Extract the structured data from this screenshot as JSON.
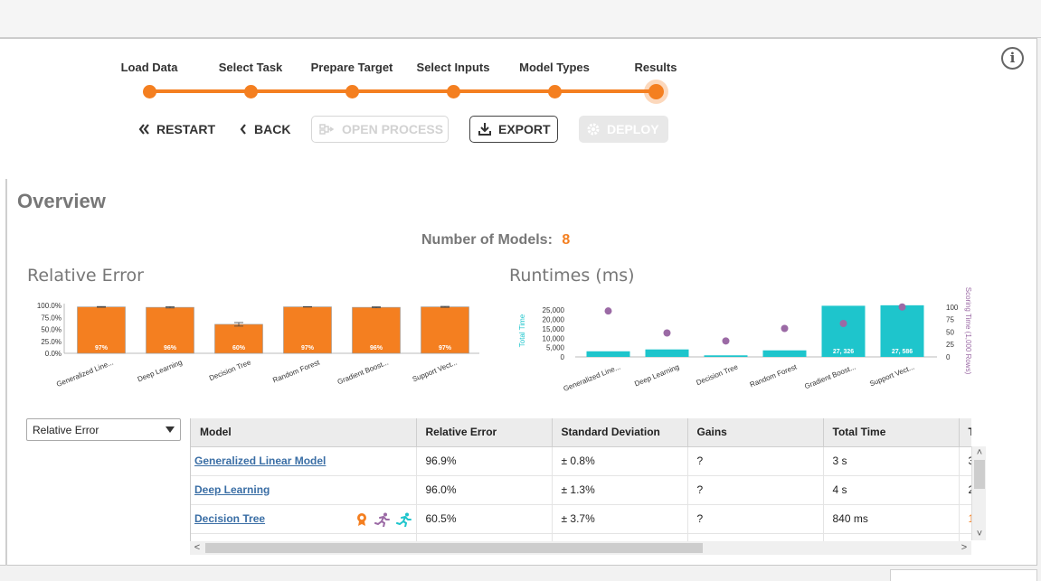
{
  "wizard": {
    "steps": [
      "Load Data",
      "Select Task",
      "Prepare Target",
      "Select Inputs",
      "Model Types",
      "Results"
    ],
    "active_step": "Results"
  },
  "toolbar": {
    "restart_label": "RESTART",
    "back_label": "BACK",
    "open_process_label": "OPEN PROCESS",
    "export_label": "EXPORT",
    "deploy_label": "DEPLOY"
  },
  "overview": {
    "title": "Overview",
    "models_label": "Number of Models:",
    "models_count": "8"
  },
  "colors": {
    "accent": "#f47f20",
    "runtime_bar": "#1ec5cc",
    "scoring_dot": "#9b6aa5",
    "link": "#3a6ea5"
  },
  "chart_data": [
    {
      "type": "bar",
      "title": "Relative Error",
      "categories": [
        "Generalized Line...",
        "Deep Learning",
        "Decision Tree",
        "Random Forest",
        "Gradient Boost...",
        "Support Vect..."
      ],
      "values": [
        96.9,
        96.0,
        60.5,
        97,
        96,
        97
      ],
      "data_labels": [
        "97%",
        "96%",
        "60%",
        "97%",
        "96%",
        "97%"
      ],
      "error": [
        0.8,
        1.3,
        3.7,
        0.5,
        1.0,
        1.0
      ],
      "ylim": [
        0,
        100
      ],
      "yticks": [
        "0.0%",
        "25.0%",
        "50.0%",
        "75.0%",
        "100.0%"
      ],
      "grid": false
    },
    {
      "type": "bar",
      "title": "Runtimes (ms)",
      "categories": [
        "Generalized Line...",
        "Deep Learning",
        "Decision Tree",
        "Random Forest",
        "Gradient Boost...",
        "Support Vect..."
      ],
      "series": [
        {
          "name": "Total Time",
          "axis": "left",
          "values": [
            3000,
            4000,
            840,
            3500,
            27326,
            27586
          ]
        },
        {
          "name": "Scoring Time (1,000 Rows)",
          "axis": "right",
          "values": [
            92,
            48,
            32,
            57,
            67,
            100
          ]
        }
      ],
      "data_labels": [
        "",
        "",
        "",
        "",
        "27, 326",
        "27, 586"
      ],
      "ylabel": "Total Time",
      "y2label": "Scoring Time (1,000 Rows)",
      "ylim": [
        0,
        28000
      ],
      "yticks": [
        "0",
        "5,000",
        "10,000",
        "15,000",
        "20,000",
        "25,000"
      ],
      "y2lim": [
        0,
        105
      ],
      "y2ticks": [
        "0",
        "25",
        "50",
        "75",
        "100"
      ]
    }
  ],
  "metric_select": {
    "value": "Relative Error"
  },
  "table": {
    "columns": [
      "Model",
      "Relative Error",
      "Standard Deviation",
      "Gains",
      "Total Time",
      "T"
    ],
    "rows": [
      {
        "model": "Generalized Linear Model",
        "relative_error": "96.9%",
        "std": "± 0.8%",
        "gains": "?",
        "total_time": "3 s",
        "extra": "3"
      },
      {
        "model": "Deep Learning",
        "relative_error": "96.0%",
        "std": "± 1.3%",
        "gains": "?",
        "total_time": "4 s",
        "extra": "2"
      },
      {
        "model": "Decision Tree",
        "relative_error": "60.5%",
        "std": "± 3.7%",
        "gains": "?",
        "total_time": "840 ms",
        "extra": "1",
        "badges": [
          "award-icon",
          "runner-icon",
          "runner-icon"
        ]
      }
    ]
  }
}
